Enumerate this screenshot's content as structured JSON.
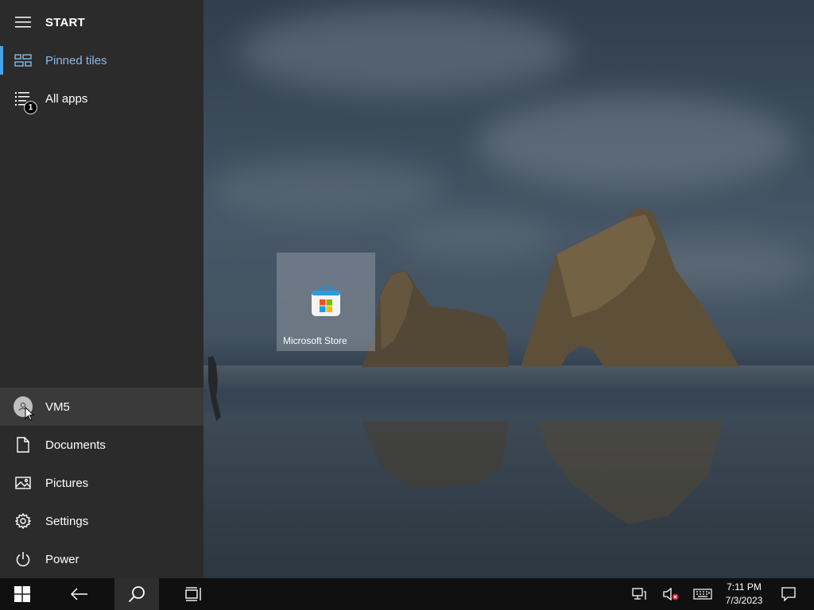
{
  "start_pane": {
    "header": "START",
    "pinned_tiles": "Pinned tiles",
    "all_apps": "All apps",
    "all_apps_badge": "1",
    "user": "VM5",
    "documents": "Documents",
    "pictures": "Pictures",
    "settings": "Settings",
    "power": "Power"
  },
  "tiles": [
    {
      "label": "Microsoft Store",
      "icon": "microsoft-store-icon"
    }
  ],
  "taskbar": {
    "time": "7:11 PM",
    "date": "7/3/2023",
    "buttons": [
      "start-button",
      "back-button",
      "search-button",
      "task-view-button"
    ],
    "tray": [
      "network-icon",
      "volume-muted-icon",
      "touch-keyboard-icon",
      "action-center-icon"
    ]
  },
  "colors": {
    "accent": "#4aa3e8",
    "sidebar_bg": "#2b2b2b",
    "taskbar_bg": "#101010"
  }
}
